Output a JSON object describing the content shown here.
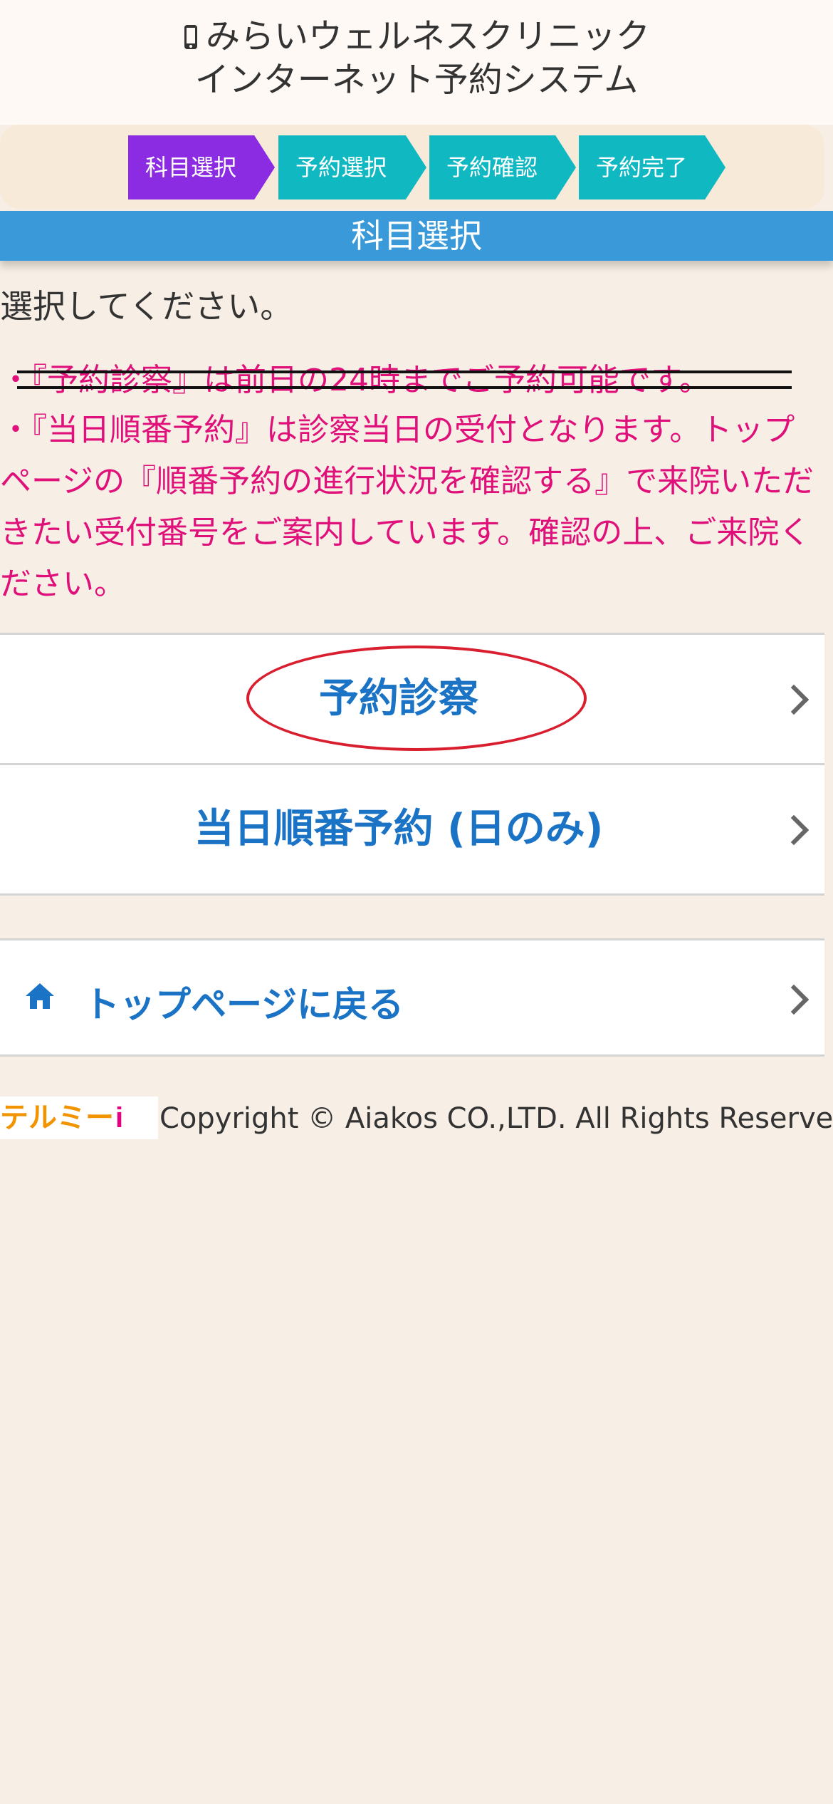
{
  "header": {
    "phone_icon": "mobile-phone-icon",
    "title_line1": "みらいウェルネスクリニック",
    "title_line2": "インターネット予約システム"
  },
  "steps": [
    {
      "label": "科目選択",
      "state": "active"
    },
    {
      "label": "予約選択",
      "state": "upcoming"
    },
    {
      "label": "予約確認",
      "state": "upcoming"
    },
    {
      "label": "予約完了",
      "state": "upcoming"
    }
  ],
  "section_title": "科目選択",
  "instruction": "選択してください。",
  "notices": {
    "struck": "・『予約診察』は前日の24時までご予約可能です。",
    "current": "・『当日順番予約』は診察当日の受付となります。トップページの『順番予約の進行状況を確認する』で来院いただきたい受付番号をご案内しています。確認の上、ご来院ください。"
  },
  "options": [
    {
      "label": "予約診察",
      "highlighted": true
    },
    {
      "label": "当日順番予約 (日のみ)",
      "highlighted": false
    }
  ],
  "home_link": {
    "icon": "home-icon",
    "label": "トップページに戻る"
  },
  "footer": {
    "logo_text": "テルミー",
    "logo_mark": "i",
    "copyright": "Copyright © Aiakos CO.,LTD. All Rights Reserved."
  },
  "colors": {
    "active_step": "#8b2be2",
    "upcoming_step": "#10b8c2",
    "section_bar": "#3a9ad9",
    "notice_text": "#e0107a",
    "link_text": "#1a73c4",
    "highlight_circle": "#d91f2f",
    "page_background": "#f7efe5"
  }
}
